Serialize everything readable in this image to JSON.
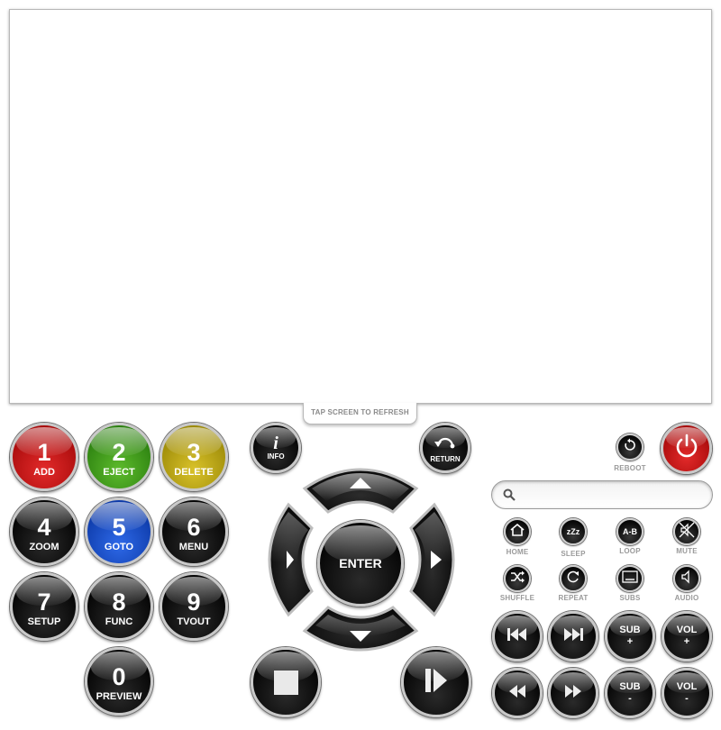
{
  "screen": {
    "refresh_label": "TAP SCREEN TO REFRESH"
  },
  "keypad": [
    {
      "digit": "1",
      "label": "ADD",
      "color": "red"
    },
    {
      "digit": "2",
      "label": "EJECT",
      "color": "green"
    },
    {
      "digit": "3",
      "label": "DELETE",
      "color": "yellow"
    },
    {
      "digit": "4",
      "label": "ZOOM",
      "color": "black"
    },
    {
      "digit": "5",
      "label": "GOTO",
      "color": "blue"
    },
    {
      "digit": "6",
      "label": "MENU",
      "color": "black"
    },
    {
      "digit": "7",
      "label": "SETUP",
      "color": "black"
    },
    {
      "digit": "8",
      "label": "FUNC",
      "color": "black"
    },
    {
      "digit": "9",
      "label": "TVOUT",
      "color": "black"
    },
    {
      "digit": "0",
      "label": "PREVIEW",
      "color": "black"
    }
  ],
  "nav": {
    "info_label": "INFO",
    "info_glyph": "i",
    "return_label": "RETURN",
    "enter_label": "ENTER"
  },
  "system": {
    "reboot_label": "REBOOT",
    "power_icon": "power-icon"
  },
  "search": {
    "placeholder": ""
  },
  "functions": [
    {
      "label": "HOME",
      "icon": "home-icon"
    },
    {
      "label": "SLEEP",
      "icon": "sleep-icon",
      "glyph": "zZz"
    },
    {
      "label": "LOOP",
      "icon": "loop-icon",
      "glyph": "A-B"
    },
    {
      "label": "MUTE",
      "icon": "mute-icon"
    },
    {
      "label": "SHUFFLE",
      "icon": "shuffle-icon"
    },
    {
      "label": "REPEAT",
      "icon": "repeat-icon"
    },
    {
      "label": "SUBS",
      "icon": "subtitles-icon"
    },
    {
      "label": "AUDIO",
      "icon": "audio-icon"
    }
  ],
  "media": {
    "sub_plus_top": "SUB",
    "sub_plus_bottom": "+",
    "vol_plus_top": "VOL",
    "vol_plus_bottom": "+",
    "sub_minus_top": "SUB",
    "sub_minus_bottom": "-",
    "vol_minus_top": "VOL",
    "vol_minus_bottom": "-"
  },
  "colors": {
    "red": "#c41414",
    "green": "#3e9a1a",
    "yellow": "#b9a412",
    "blue": "#1d4fd0",
    "black": "#0a0a0a"
  }
}
